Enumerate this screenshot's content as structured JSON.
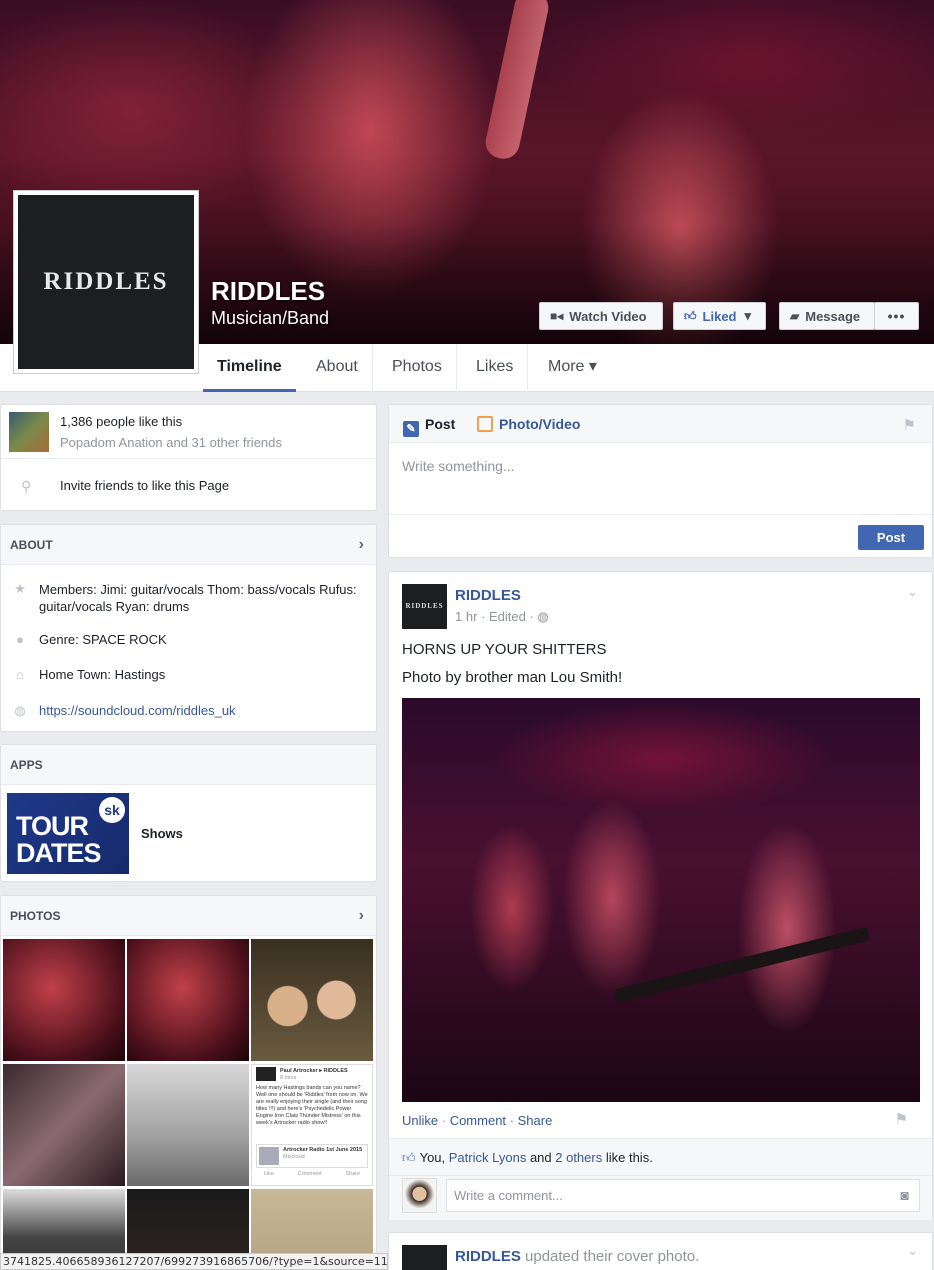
{
  "page": {
    "logo_text": "RIDDLES",
    "name": "RIDDLES",
    "category": "Musician/Band"
  },
  "cover_buttons": {
    "watch_video": "Watch Video",
    "liked": "Liked",
    "message": "Message",
    "more": "•••"
  },
  "nav": {
    "tabs": [
      "Timeline",
      "About",
      "Photos",
      "Likes",
      "More ▾"
    ]
  },
  "likes_card": {
    "count_text": "1,386 people like this",
    "friends_text": "Popadom Anation and 31 other friends",
    "invite_text": "Invite friends to like this Page"
  },
  "about": {
    "header": "ABOUT",
    "members": "Members: Jimi: guitar/vocals Thom: bass/vocals Rufus: guitar/vocals Ryan: drums",
    "genre": "Genre: SPACE ROCK",
    "hometown": "Home Town: Hastings",
    "link": "https://soundcloud.com/riddles_uk"
  },
  "apps": {
    "header": "APPS",
    "tile_line1": "TOUR",
    "tile_line2": "DATES",
    "tile_badge": "sk",
    "app_name": "Shows"
  },
  "photos": {
    "header": "PHOTOS",
    "screenshot_tile": {
      "author": "Paul Artrocker ▸ RIDDLES",
      "time": "8 mins · ",
      "body": "How many Hastings bands can you name? Well one should be 'Riddles' from now on. We are really enjoying their single (and their song titles !!!) and here's 'Psychedelic Power Engine Iron Claw Thunder Mistress' on this week's Artrocker radio show!!",
      "link_title": "Artrocker Radio 1st June 2015",
      "link_source": "Mixcloud",
      "actions": [
        "Like",
        "Comment",
        "Share"
      ]
    }
  },
  "composer": {
    "tab_post": "Post",
    "tab_photo": "Photo/Video",
    "placeholder": "Write something...",
    "post_button": "Post"
  },
  "post1": {
    "author": "RIDDLES",
    "meta": "1 hr · Edited · ",
    "line1": "HORNS UP YOUR SHITTERS",
    "line2": "Photo by brother man Lou Smith!",
    "actions": {
      "unlike": "Unlike",
      "comment": "Comment",
      "share": "Share",
      "sep": " · "
    },
    "likes": {
      "you": "You, ",
      "friend": "Patrick Lyons",
      "and": " and ",
      "others": "2 others",
      "tail": " like this."
    },
    "comment_placeholder": "Write a comment..."
  },
  "post2": {
    "author": "RIDDLES",
    "action_text": " updated their cover photo."
  },
  "status_bar": {
    "url": "3741825.406658936127207/699273916865706/?type=1&source=11"
  },
  "colors": {
    "accent": "#4267b2",
    "link": "#365899",
    "background": "#e9ebee"
  }
}
